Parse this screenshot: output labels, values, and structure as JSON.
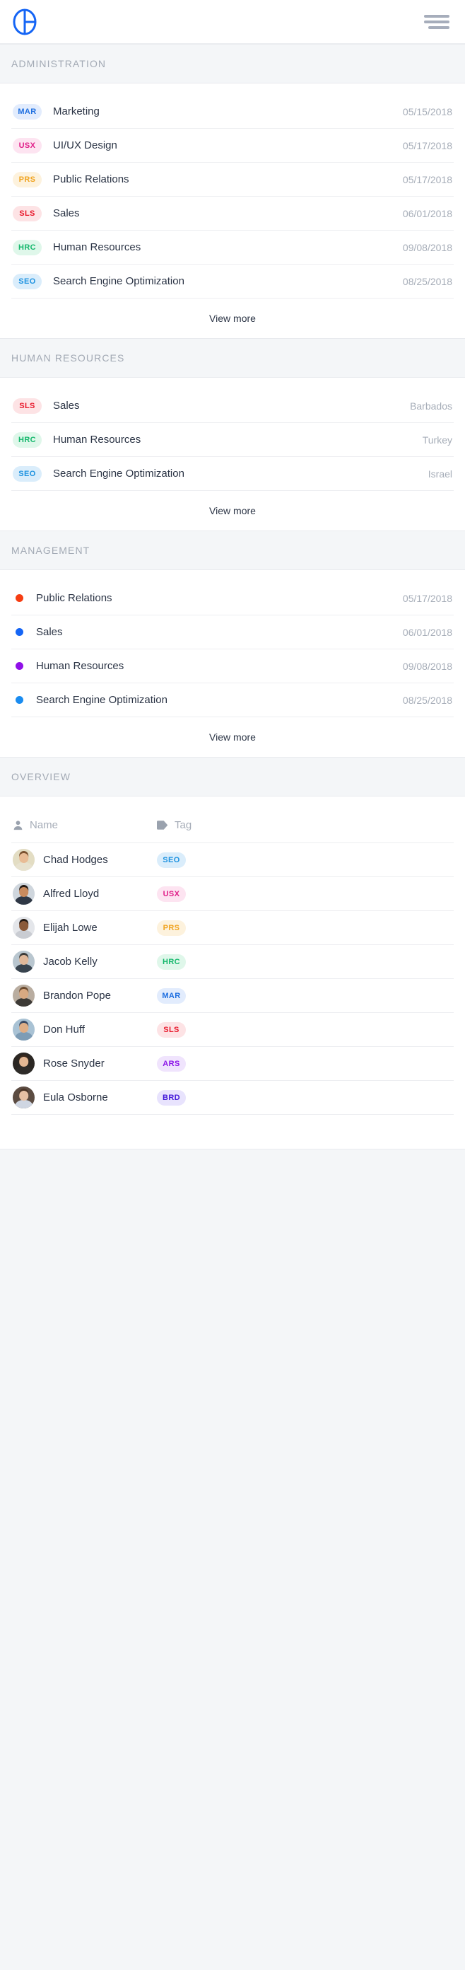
{
  "topbar": {
    "logo_name": "pie-chart-logo",
    "logo_color": "#1565f5",
    "menu_label": "menu-icon",
    "menu_color": "#a6adbb"
  },
  "sections": [
    {
      "id": "administration",
      "title": "ADMINISTRATION",
      "view_more": "View more",
      "marker_type": "badge",
      "rows": [
        {
          "badge": "MAR",
          "label": "Marketing",
          "meta": "05/15/2018",
          "fg": "#1f6fe0",
          "bg": "#e2ecfd"
        },
        {
          "badge": "USX",
          "label": "UI/UX Design",
          "meta": "05/17/2018",
          "fg": "#e0218a",
          "bg": "#fde4f1"
        },
        {
          "badge": "PRS",
          "label": "Public Relations",
          "meta": "05/17/2018",
          "fg": "#f0a422",
          "bg": "#fdf2dd"
        },
        {
          "badge": "SLS",
          "label": "Sales",
          "meta": "06/01/2018",
          "fg": "#e8192c",
          "bg": "#fde3e5"
        },
        {
          "badge": "HRC",
          "label": "Human Resources",
          "meta": "09/08/2018",
          "fg": "#16b86d",
          "bg": "#dff7ea"
        },
        {
          "badge": "SEO",
          "label": "Search Engine Optimization",
          "meta": "08/25/2018",
          "fg": "#1f93e0",
          "bg": "#daedfb"
        }
      ]
    },
    {
      "id": "human-resources",
      "title": "HUMAN RESOURCES",
      "view_more": "View more",
      "marker_type": "badge",
      "rows": [
        {
          "badge": "SLS",
          "label": "Sales",
          "meta": "Barbados",
          "fg": "#e8192c",
          "bg": "#fde3e5"
        },
        {
          "badge": "HRC",
          "label": "Human Resources",
          "meta": "Turkey",
          "fg": "#16b86d",
          "bg": "#dff7ea"
        },
        {
          "badge": "SEO",
          "label": "Search Engine Optimization",
          "meta": "Israel",
          "fg": "#1f93e0",
          "bg": "#daedfb"
        }
      ]
    },
    {
      "id": "management",
      "title": "MANAGEMENT",
      "view_more": "View more",
      "marker_type": "dot",
      "rows": [
        {
          "label": "Public Relations",
          "meta": "05/17/2018",
          "dot": "#f63d12"
        },
        {
          "label": "Sales",
          "meta": "06/01/2018",
          "dot": "#1565f5"
        },
        {
          "label": "Human Resources",
          "meta": "09/08/2018",
          "dot": "#9010e8"
        },
        {
          "label": "Search Engine Optimization",
          "meta": "08/25/2018",
          "dot": "#1a8cf0"
        }
      ]
    }
  ],
  "overview": {
    "title": "OVERVIEW",
    "columns": [
      {
        "label": "Name",
        "icon": "person-icon"
      },
      {
        "label": "Tag",
        "icon": "tag-icon"
      }
    ],
    "rows": [
      {
        "name": "Chad Hodges",
        "tag": "SEO",
        "fg": "#1f93e0",
        "bg": "#daedfb",
        "skin": "#e8bc95",
        "hair": "#7a5230",
        "cloth": "#e7e2cf",
        "bgc": "#e3ddc3"
      },
      {
        "name": "Alfred Lloyd",
        "tag": "USX",
        "fg": "#e0218a",
        "bg": "#fde4f1",
        "skin": "#c98b5e",
        "hair": "#241a14",
        "cloth": "#2f3845",
        "bgc": "#cfd6dd"
      },
      {
        "name": "Elijah Lowe",
        "tag": "PRS",
        "fg": "#f0a422",
        "bg": "#fdf2dd",
        "skin": "#8a5a3a",
        "hair": "#241a14",
        "cloth": "#c9ccd2",
        "bgc": "#e4e6ea"
      },
      {
        "name": "Jacob Kelly",
        "tag": "HRC",
        "fg": "#16b86d",
        "bg": "#dff7ea",
        "skin": "#e0b89a",
        "hair": "#3b3a38",
        "cloth": "#39444f",
        "bgc": "#b9c6cf"
      },
      {
        "name": "Brandon Pope",
        "tag": "MAR",
        "fg": "#1f6fe0",
        "bg": "#e2ecfd",
        "skin": "#d8a982",
        "hair": "#6b4a2e",
        "cloth": "#3d3a36",
        "bgc": "#b9ada0"
      },
      {
        "name": "Don Huff",
        "tag": "SLS",
        "fg": "#e8192c",
        "bg": "#fde3e5",
        "skin": "#dfae86",
        "hair": "#3b4a63",
        "cloth": "#7d9cb5",
        "bgc": "#a9c2d4"
      },
      {
        "name": "Rose Snyder",
        "tag": "ARS",
        "fg": "#8b14e8",
        "bg": "#f0e4fd",
        "skin": "#e3b793",
        "hair": "#3a2a1e",
        "cloth": "#2e2b28",
        "bgc": "#2b2723"
      },
      {
        "name": "Eula Osborne",
        "tag": "BRD",
        "fg": "#4318d9",
        "bg": "#e8e3fd",
        "skin": "#e6c0a4",
        "hair": "#4a3426",
        "cloth": "#cfd6e2",
        "bgc": "#5c4c42"
      }
    ]
  }
}
